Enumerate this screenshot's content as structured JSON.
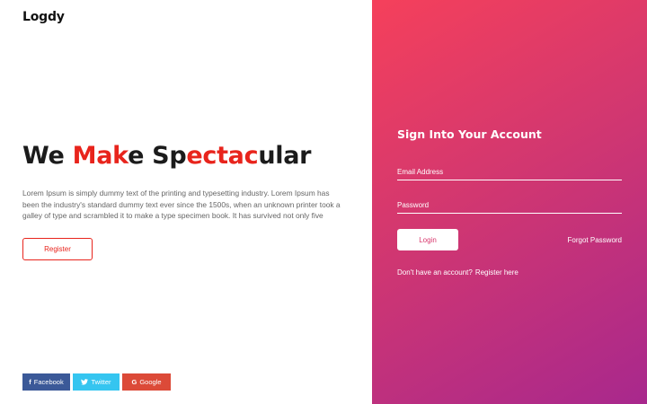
{
  "brand": {
    "logo_text": "Logdy"
  },
  "hero": {
    "headline_parts": [
      "We ",
      "Mak",
      "e Sp",
      "ectac",
      "ular"
    ],
    "description": "Lorem Ipsum is simply dummy text of the printing and typesetting industry. Lorem Ipsum has been the industry's standard dummy text ever since the 1500s, when an unknown printer took a galley of type and scrambled it to make a type specimen book. It has survived not only five",
    "register_label": "Register",
    "accent_color": "#e8241c"
  },
  "social": {
    "facebook_label": "Facebook",
    "twitter_label": "Twitter",
    "google_label": "Google",
    "colors": {
      "facebook": "#3b5998",
      "twitter": "#35c5f0",
      "google": "#dc4a38"
    }
  },
  "login_form": {
    "title": "Sign Into Your Account",
    "email_placeholder": "Email Address",
    "password_placeholder": "Password",
    "login_label": "Login",
    "forgot_label": "Forgot Password",
    "signup_prompt": "Don't have an account?",
    "signup_link": "Register here",
    "gradient_colors": [
      "#f5405b",
      "#d23770",
      "#a8288d"
    ]
  }
}
